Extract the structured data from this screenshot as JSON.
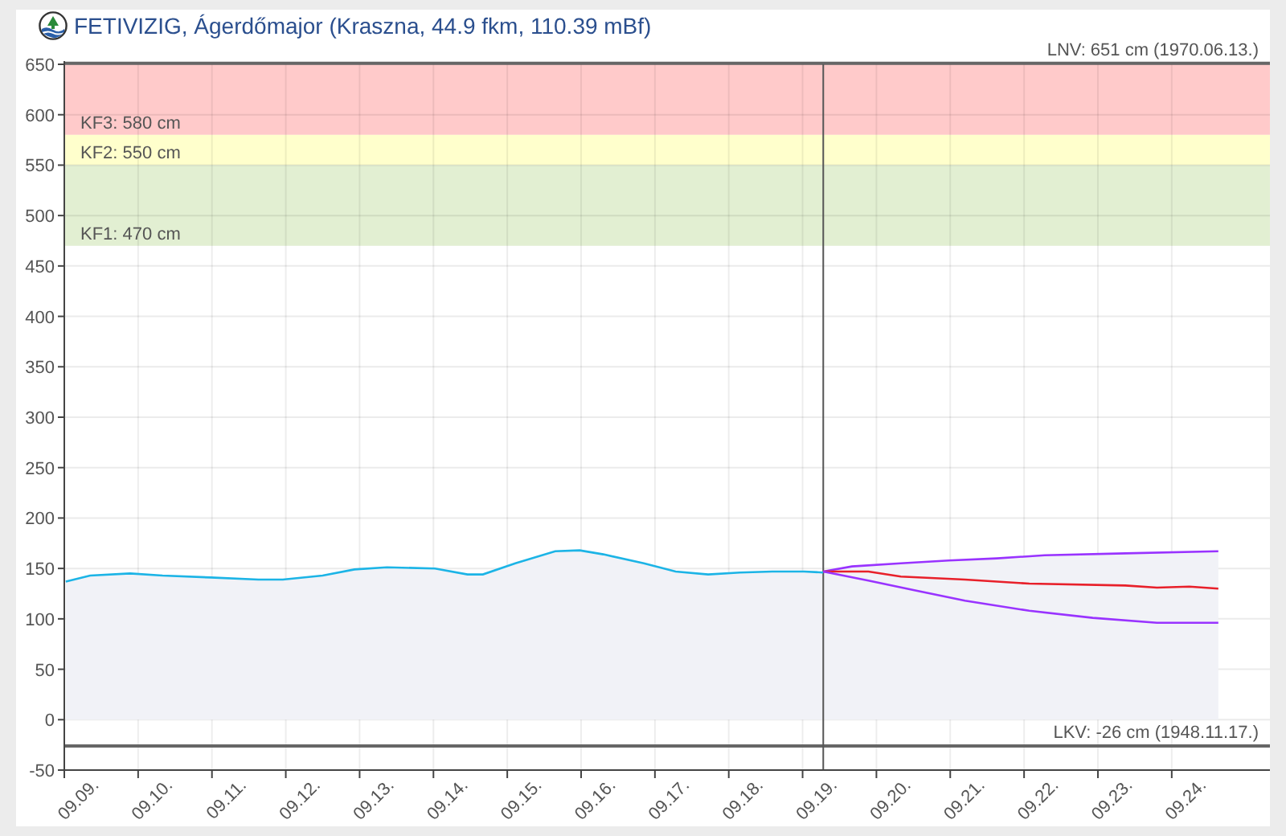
{
  "title": "FETIVIZIG, Ágerdőmajor (Kraszna, 44.9 fkm, 110.39 mBf)",
  "chart_data": {
    "type": "area",
    "grid": true,
    "xlim": [
      9.09,
      9.2533
    ],
    "ylim": [
      -50,
      650
    ],
    "yticks": [
      -50,
      0,
      50,
      100,
      150,
      200,
      250,
      300,
      350,
      400,
      450,
      500,
      550,
      600,
      650
    ],
    "xticks": [
      {
        "value": 9.09,
        "label": "09.09."
      },
      {
        "value": 9.1,
        "label": "09.10."
      },
      {
        "value": 9.11,
        "label": "09.11."
      },
      {
        "value": 9.12,
        "label": "09.12."
      },
      {
        "value": 9.13,
        "label": "09.13."
      },
      {
        "value": 9.14,
        "label": "09.14."
      },
      {
        "value": 9.15,
        "label": "09.15."
      },
      {
        "value": 9.16,
        "label": "09.16."
      },
      {
        "value": 9.17,
        "label": "09.17."
      },
      {
        "value": 9.18,
        "label": "09.18."
      },
      {
        "value": 9.19,
        "label": "09.19."
      },
      {
        "value": 9.2,
        "label": "09.20."
      },
      {
        "value": 9.21,
        "label": "09.21."
      },
      {
        "value": 9.22,
        "label": "09.22."
      },
      {
        "value": 9.23,
        "label": "09.23."
      },
      {
        "value": 9.24,
        "label": "09.24."
      }
    ],
    "series": [
      {
        "type": "area",
        "color": "#1cb4e6",
        "x": [
          9.0902,
          9.0935,
          9.0989,
          9.1033,
          9.1098,
          9.1163,
          9.1196,
          9.125,
          9.1293,
          9.1337,
          9.1402,
          9.1446,
          9.1467,
          9.1511,
          9.1565,
          9.1598,
          9.163,
          9.1685,
          9.1728,
          9.1772,
          9.1815,
          9.1859,
          9.1902,
          9.1928
        ],
        "values": [
          137,
          143,
          145,
          143,
          141,
          139,
          139,
          143,
          149,
          151,
          150,
          144,
          144,
          155,
          167,
          168,
          164,
          155,
          147,
          144,
          146,
          147,
          147,
          146
        ]
      },
      {
        "type": "area",
        "color": "#9933ff",
        "x": [
          9.1928,
          9.1967,
          9.2033,
          9.2098,
          9.2163,
          9.2228,
          9.2337,
          9.2463
        ],
        "values": [
          147,
          152,
          155,
          158,
          160,
          163,
          165,
          167
        ]
      },
      {
        "type": "line",
        "color": "#e8202a",
        "x": [
          9.1928,
          9.1989,
          9.2033,
          9.212,
          9.2207,
          9.2337,
          9.238,
          9.2424,
          9.2463
        ],
        "values": [
          147,
          147,
          142,
          139,
          135,
          133,
          131,
          132,
          130
        ]
      },
      {
        "type": "line",
        "color": "#9933ff",
        "x": [
          9.1928,
          9.1989,
          9.2054,
          9.212,
          9.2207,
          9.2293,
          9.238,
          9.2463
        ],
        "values": [
          147,
          138,
          128,
          118,
          108,
          101,
          96,
          96
        ]
      }
    ],
    "bands": [
      {
        "axis": "y",
        "from": 580,
        "to": 650,
        "color": "#ffcaca",
        "label": "KF3: 580 cm"
      },
      {
        "axis": "y",
        "from": 550,
        "to": 580,
        "color": "#ffffcc",
        "label": "KF2: 550 cm"
      },
      {
        "axis": "y",
        "from": 470,
        "to": 550,
        "color": "#e2efd2",
        "label": "KF1: 470 cm"
      }
    ],
    "ref_lines": [
      {
        "axis": "y",
        "value": 651,
        "label": "LNV: 651 cm (1970.06.13.)"
      },
      {
        "axis": "y",
        "value": -26,
        "label": "LKV: -26 cm (1948.11.17.)"
      },
      {
        "axis": "x",
        "value": 9.1928
      }
    ]
  }
}
